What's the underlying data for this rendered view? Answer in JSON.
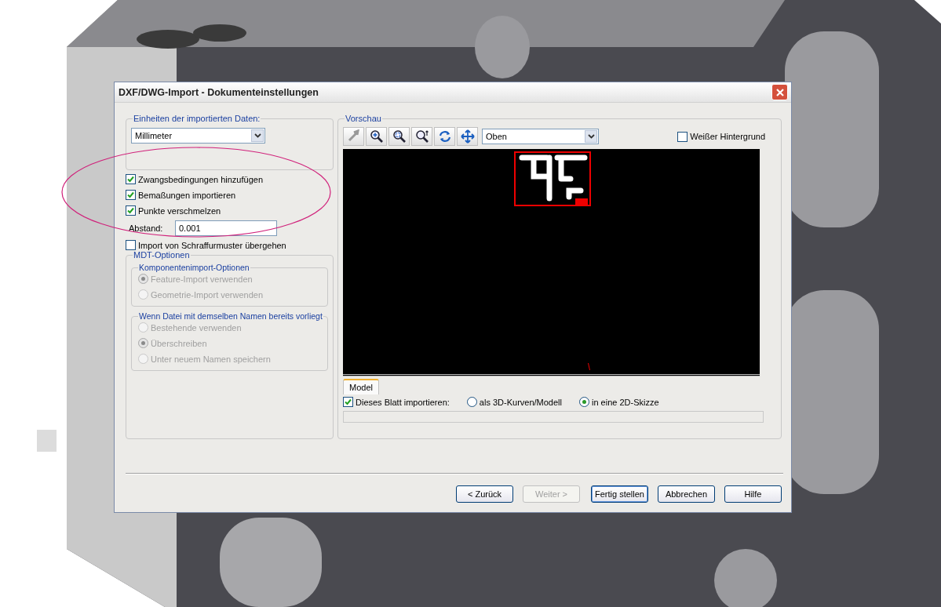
{
  "dialog": {
    "title": "DXF/DWG-Import - Dokumenteinstellungen"
  },
  "units": {
    "label": "Einheiten der importierten Daten:",
    "value": "Millimeter"
  },
  "options": [
    {
      "label": "Zwangsbedingungen hinzufügen",
      "checked": true
    },
    {
      "label": "Bemaßungen importieren",
      "checked": true
    },
    {
      "label": "Punkte verschmelzen",
      "checked": true
    }
  ],
  "distance": {
    "label": "Abstand:",
    "value": "0.001"
  },
  "skip_hatch": {
    "label": "Import von Schraffurmuster übergehen",
    "checked": false
  },
  "mdt": {
    "title": "MDT-Optionen",
    "disabled": true,
    "groups": [
      {
        "title": "Komponentenimport-Optionen",
        "options": [
          {
            "label": "Feature-Import verwenden",
            "selected": true
          },
          {
            "label": "Geometrie-Import verwenden",
            "selected": false
          }
        ]
      },
      {
        "title": "Wenn Datei mit demselben Namen bereits vorliegt",
        "options": [
          {
            "label": "Bestehende verwenden",
            "selected": false
          },
          {
            "label": "Überschreiben",
            "selected": true
          },
          {
            "label": "Unter neuem Namen speichern",
            "selected": false
          }
        ]
      }
    ]
  },
  "preview": {
    "title": "Vorschau",
    "view": "Oben",
    "white_background": {
      "label": "Weißer Hintergrund",
      "checked": false
    },
    "tabs": [
      {
        "label": "Model",
        "selected": true
      }
    ],
    "import_sheet": {
      "label": "Dieses Blatt importieren:",
      "checked": true
    },
    "import_modes": [
      {
        "label": "als 3D-Kurven/Modell",
        "selected": false
      },
      {
        "label": "in eine 2D-Skizze",
        "selected": true
      }
    ],
    "progress": {
      "level": 0
    }
  },
  "buttons": [
    {
      "label": "< Zurück",
      "disabled": false,
      "default": false
    },
    {
      "label": "Weiter >",
      "disabled": true,
      "default": false
    },
    {
      "label": "Fertig stellen",
      "disabled": false,
      "default": true
    },
    {
      "label": "Abbrechen",
      "disabled": false,
      "default": false
    },
    {
      "label": "Hilfe",
      "disabled": false,
      "default": false
    }
  ]
}
